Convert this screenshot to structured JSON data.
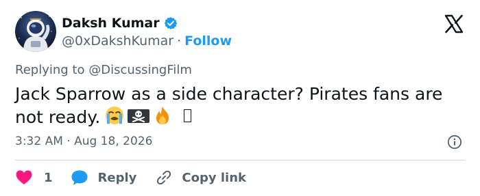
{
  "author": {
    "display_name": "Daksh Kumar",
    "handle": "@0xDakshKumar",
    "separator": "·",
    "follow_label": "Follow",
    "verified": true
  },
  "tweet": {
    "replying_prefix": "Replying to",
    "replying_to": "@DiscussingFilm",
    "text": "Jack Sparrow as a side character? Pirates fans are not ready.",
    "emojis": [
      "loudly-crying-face",
      "pirate-flag",
      "fire",
      "missing-glyph"
    ],
    "timestamp": "3:32 AM · Aug 18, 2026"
  },
  "actions": {
    "like_count": "1",
    "reply_label": "Reply",
    "copy_link_label": "Copy link"
  },
  "colors": {
    "brand_blue": "#1d9bf0",
    "verified_blue": "#1d9bf0",
    "like_pink": "#f91880",
    "text_secondary": "#536471",
    "divider": "#cfd9de"
  }
}
